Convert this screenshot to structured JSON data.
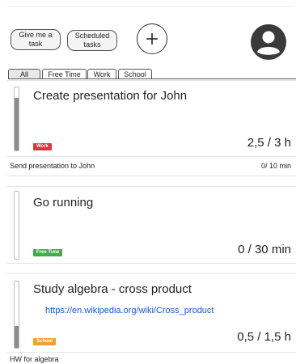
{
  "toolbar": {
    "give_task_label": "Give me a task",
    "scheduled_label": "Scheduled tasks",
    "add_icon": "plus-icon",
    "avatar_icon": "user-avatar-icon"
  },
  "tabs": [
    {
      "label": "All",
      "active": true
    },
    {
      "label": "Free Time",
      "active": false
    },
    {
      "label": "Work",
      "active": false
    },
    {
      "label": "School",
      "active": false
    }
  ],
  "colors": {
    "work": "#d9363e",
    "free_time": "#3fae4a",
    "school": "#f0a030",
    "link": "#1a56d6"
  },
  "tasks": [
    {
      "title": "Create presentation for John",
      "category": "Work",
      "time": "2,5 / 3 h",
      "progress": 0.83,
      "subtask": {
        "label": "Send presentation to John",
        "time": "0/ 10 min"
      }
    },
    {
      "title": "Go running",
      "category": "Free Time",
      "time": "0 / 30 min",
      "progress": 0.0
    },
    {
      "title": "Study algebra - cross product",
      "category": "School",
      "time": "0,5 / 1,5 h",
      "progress": 0.33,
      "link": "https://en.wikipedia.org/wiki/Cross_product",
      "subtask": {
        "label": "HW for algebra"
      }
    }
  ]
}
